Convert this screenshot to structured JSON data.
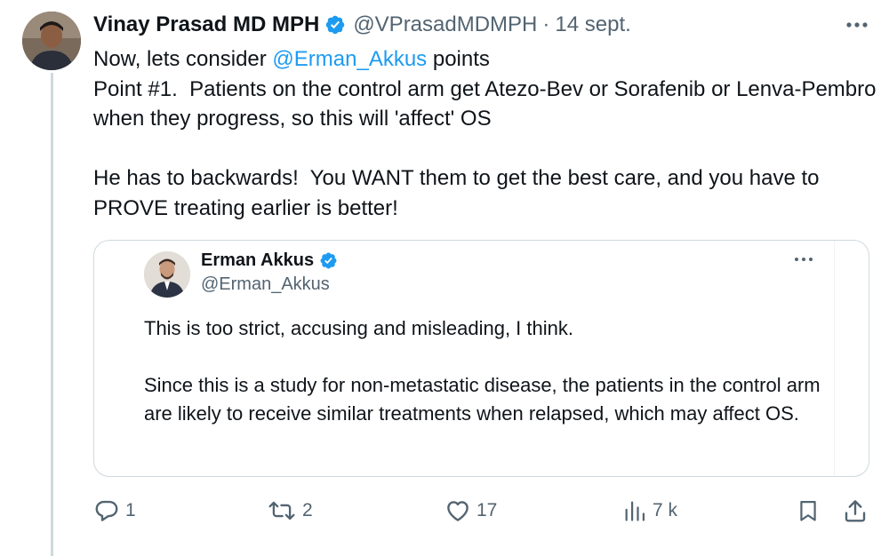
{
  "tweet": {
    "author_name": "Vinay Prasad MD MPH",
    "author_handle": "@VPrasadMDMPH",
    "separator": "·",
    "date": "14 sept.",
    "text_intro": "Now, lets consider ",
    "mention": "@Erman_Akkus",
    "text_intro_end": " points",
    "point_line": "Point #1.  Patients on the control arm get Atezo-Bev or Sorafenib or Lenva-Pembro when they progress, so this will 'affect' OS",
    "reply_paragraph": "He has to backwards!  You WANT them to get the best care, and you have to PROVE treating earlier is better!"
  },
  "quoted_tweet": {
    "author_name": "Erman Akkus",
    "author_handle": "@Erman_Akkus",
    "paragraph_1": "This is too strict, accusing and misleading, I think.",
    "paragraph_2": "Since this is a study for non-metastatic disease, the patients in the control arm are likely to receive similar treatments when relapsed, which may affect OS."
  },
  "actions": {
    "reply_count": "1",
    "retweet_count": "2",
    "like_count": "17",
    "views_count": "7 k"
  },
  "icons": {
    "verified": "verified-badge-icon",
    "more": "more-dots-icon",
    "reply": "reply-bubble-icon",
    "retweet": "retweet-arrows-icon",
    "like": "heart-icon",
    "views": "bar-chart-icon",
    "bookmark": "bookmark-icon",
    "share": "share-upload-icon"
  },
  "colors": {
    "accent": "#1d9bf0",
    "text": "#0f1419",
    "muted": "#536471",
    "border": "#cfd9de"
  }
}
